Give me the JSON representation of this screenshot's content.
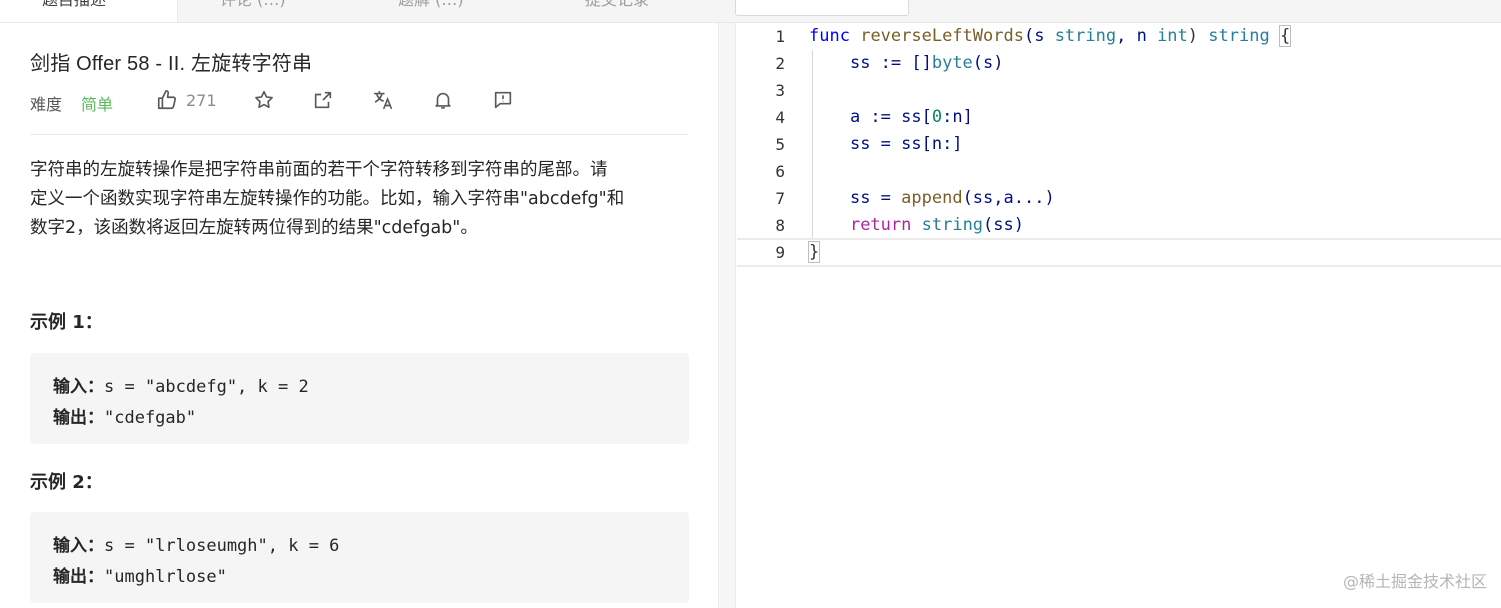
{
  "tabs": [
    "题目描述",
    "评论 (…)",
    "题解 (…)",
    "提交记录"
  ],
  "problem": {
    "title": "剑指 Offer 58 - II. 左旋转字符串",
    "difficulty_label": "难度",
    "difficulty": "简单",
    "likes": "271",
    "description_lines": [
      "字符串的左旋转操作是把字符串前面的若干个字符转移到字符串的尾部。请",
      "定义一个函数实现字符串左旋转操作的功能。比如，输入字符串\"abcdefg\"和",
      "数字2，该函数将返回左旋转两位得到的结果\"cdefgab\"。"
    ]
  },
  "examples": [
    {
      "heading": "示例 1：",
      "input_key": "输入：",
      "input": "s = \"abcdefg\", k = 2",
      "output_key": "输出：",
      "output": "\"cdefgab\""
    },
    {
      "heading": "示例 2：",
      "input_key": "输入：",
      "input": "s = \"lrloseumgh\", k = 6",
      "output_key": "输出：",
      "output": "\"umghlrlose\""
    }
  ],
  "editor": {
    "line_numbers": [
      "1",
      "2",
      "3",
      "4",
      "5",
      "6",
      "7",
      "8",
      "9"
    ],
    "line1": {
      "kw": "func",
      "fn": "reverseLeftWords",
      "p1": "(s ",
      "t1": "string",
      ", n ": ", n ",
      "t2": "int",
      ") ": ") ",
      "t3": "string",
      "brace": "{"
    },
    "line2": {
      "a": "ss := []",
      "t": "byte",
      "b": "(s)"
    },
    "line4": {
      "a": "a := ss[",
      "n": "0",
      "b": ":n]"
    },
    "line5": {
      "a": "ss = ss[n:]"
    },
    "line7": {
      "a": "ss = ",
      "fn": "append",
      "b": "(ss,a...)"
    },
    "line8": {
      "kw": "return",
      "t": "string",
      "b": "(ss)"
    },
    "line9": {
      "brace": "}"
    }
  },
  "watermark": "@稀土掘金技术社区"
}
